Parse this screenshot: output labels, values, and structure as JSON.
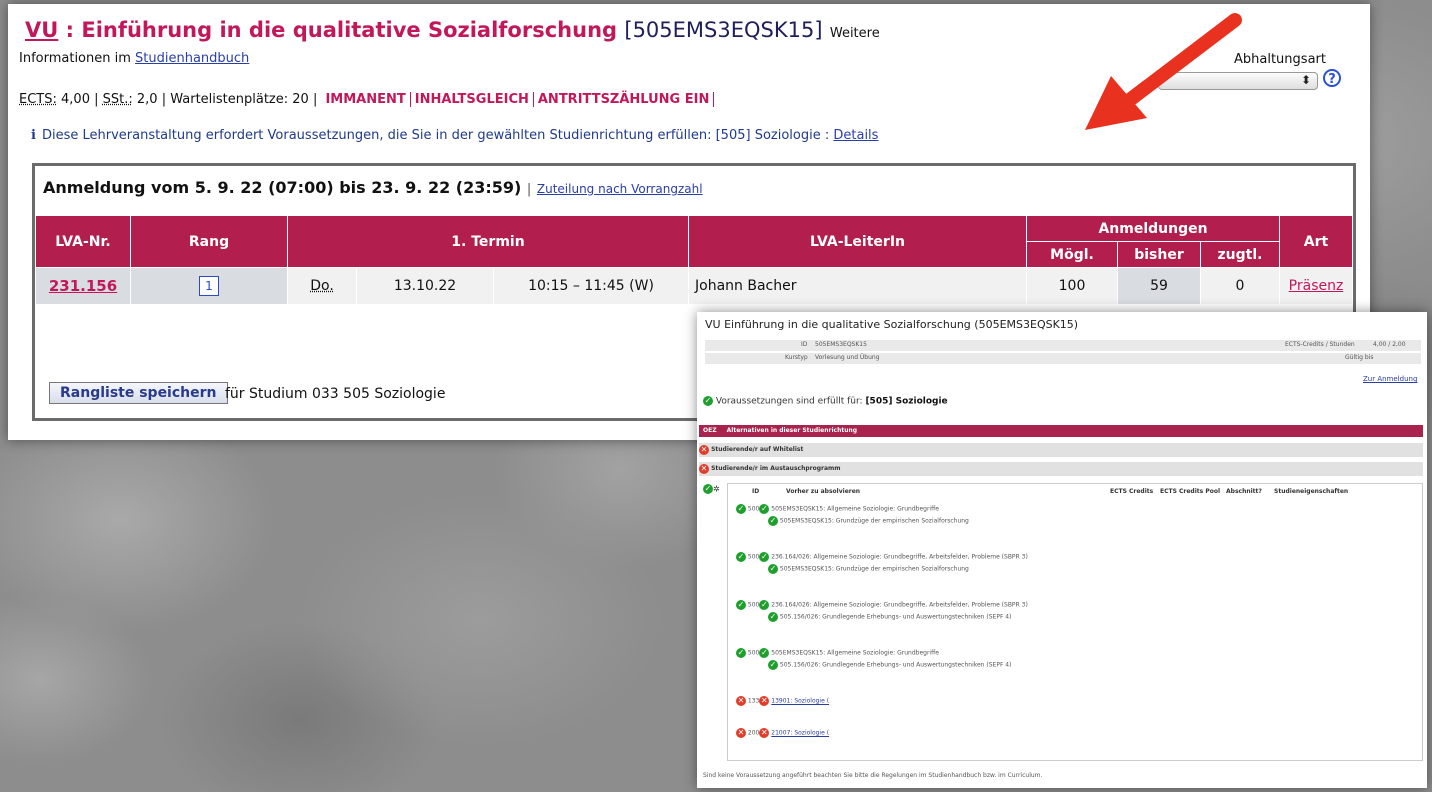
{
  "course": {
    "type": "VU",
    "separator": " : ",
    "title": "Einführung in die qualitative Sozialforschung",
    "code": "[505EMS3EQSK15]",
    "weitere": "Weitere",
    "info_prefix": "Informationen im ",
    "studienhandbuch_link": "Studienhandbuch"
  },
  "abhaltungsart": {
    "label": "Abhaltungsart",
    "value": ""
  },
  "stats": {
    "ects_label": "ECTS:",
    "ects_value": "4,00",
    "sst_label": "SSt.:",
    "sst_value": "2,0",
    "warte_label": "Wartelistenplätze:",
    "warte_value": "20",
    "badges": [
      "IMMANENT",
      "INHALTSGLEICH",
      "ANTRITTSZÄHLUNG EIN"
    ]
  },
  "notice": {
    "text": "Diese Lehrveranstaltung erfordert Voraussetzungen, die Sie in der gewählten Studienrichtung erfüllen: [505] Soziologie : ",
    "link": "Details"
  },
  "registration": {
    "title": "Anmeldung vom 5. 9. 22 (07:00)  bis 23. 9. 22 (23:59)",
    "link": "Zuteilung nach Vorrangzahl",
    "headers": {
      "lvanr": "LVA-Nr.",
      "rang": "Rang",
      "termin": "1. Termin",
      "leiter": "LVA-LeiterIn",
      "anmeldungen": "Anmeldungen",
      "moegl": "Mögl.",
      "bisher": "bisher",
      "zugtl": "zugtl.",
      "art": "Art"
    },
    "row": {
      "lvanr": "231.156",
      "rang": "1",
      "day": "Do.",
      "date": "13.10.22",
      "time": "10:15 – 11:45 (W)",
      "leiter": "Johann Bacher",
      "moegl": "100",
      "bisher": "59",
      "zugtl": "0",
      "art": "Präsenz"
    },
    "save_button": "Rangliste speichern",
    "save_label": "für Studium 033 505 Soziologie"
  },
  "popup": {
    "title": "VU Einführung in die qualitative Sozialforschung (505EMS3EQSK15)",
    "meta": {
      "id_label": "ID",
      "id_value": "505EMS3EQSK15",
      "kurstyp_label": "Kurstyp",
      "kurstyp_value": "Vorlesung und Übung",
      "ects_label": "ECTS-Credits / Stunden",
      "ects_value": "4,00 / 2,00",
      "gueltig_label": "Gültig bis"
    },
    "zur_link": "Zur Anmeldung",
    "voraussetzung_prefix": "Voraussetzungen sind erfüllt für: ",
    "voraussetzung_bold": "[505] Soziologie",
    "section_tag": "OEZ",
    "section_title": "Alternativen in dieser Studienrichtung",
    "rows": [
      "Studierende/r auf Whitelist",
      "Studierende/r im Austauschprogramm"
    ],
    "grid_headers": [
      "ID",
      "Vorher zu absolvieren",
      "ECTS Credits",
      "ECTS Credits Pool",
      "Abschnitt?",
      "Studieneigenschaften"
    ],
    "entries": [
      {
        "id": "500",
        "lines": [
          "505EMS3EQSK15: Allgemeine Soziologie: Grundbegriffe",
          "505EMS3EQSK15: Grundzüge der empirischen Sozialforschung"
        ]
      },
      {
        "id": "500",
        "lines": [
          "236.164/026: Allgemeine Soziologie: Grundbegriffe, Arbeitsfelder, Probleme (SBPR 3)",
          "505EMS3EQSK15: Grundzüge der empirischen Sozialforschung"
        ]
      },
      {
        "id": "500",
        "lines": [
          "236.164/026: Allgemeine Soziologie: Grundbegriffe, Arbeitsfelder, Probleme (SBPR 3)",
          "505.156/026: Grundlegende Erhebungs- und Auswertungstechniken (SEPF 4)"
        ]
      },
      {
        "id": "500",
        "lines": [
          "505EMS3EQSK15: Allgemeine Soziologie: Grundbegriffe",
          "505.156/026: Grundlegende Erhebungs- und Auswertungstechniken (SEPF 4)"
        ]
      },
      {
        "id": "133",
        "lines": [
          "13901: Soziologie (",
          ""
        ]
      },
      {
        "id": "200",
        "lines": [
          "21007: Soziologie (",
          ""
        ]
      }
    ],
    "footer": "Sind keine Voraussetzung angeführt beachten Sie bitte die Regelungen im Studienhandbuch bzw. im Curriculum."
  }
}
